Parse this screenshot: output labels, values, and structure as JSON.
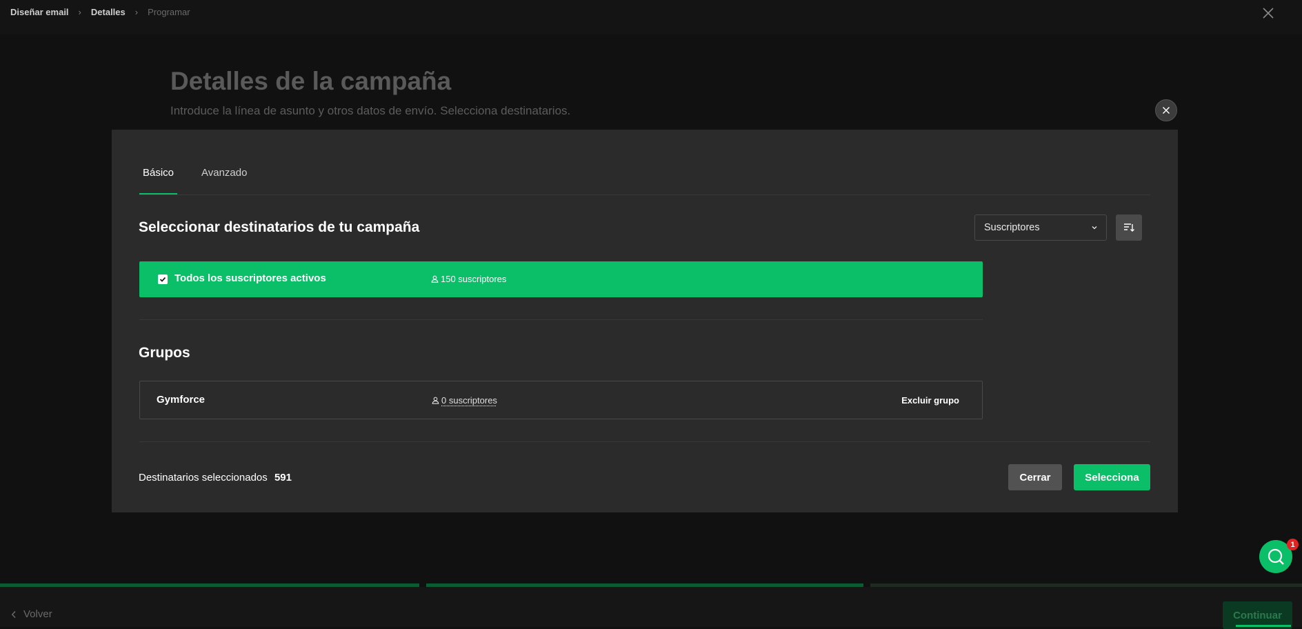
{
  "breadcrumb": {
    "items": [
      "Diseñar email",
      "Detalles",
      "Programar"
    ]
  },
  "page": {
    "title": "Detalles de la campaña",
    "subtitle": "Introduce la línea de asunto y otros datos de envío. Selecciona destinatarios."
  },
  "modal": {
    "tabs": [
      {
        "label": "Básico",
        "active": true
      },
      {
        "label": "Avanzado",
        "active": false
      }
    ],
    "section_title": "Seleccionar destinatarios de tu campaña",
    "filter_dropdown": {
      "selected": "Suscriptores"
    },
    "all_subscribers": {
      "label": "Todos los suscriptores activos",
      "count": "150 suscriptores",
      "checked": true
    },
    "groups_title": "Grupos",
    "groups": [
      {
        "name": "Gymforce",
        "count": "0 suscriptores",
        "action": "Excluir grupo"
      }
    ],
    "footer": {
      "selected_label": "Destinatarios seleccionados",
      "selected_count": "591",
      "close_label": "Cerrar",
      "select_label": "Selecciona"
    }
  },
  "chat": {
    "badge": "1"
  },
  "bottom": {
    "back_label": "Volver",
    "continue_label": "Continuar"
  },
  "colors": {
    "accent": "#0bbf69",
    "background": "#111111",
    "modal": "#2b2b2b",
    "badge": "#e02424"
  }
}
